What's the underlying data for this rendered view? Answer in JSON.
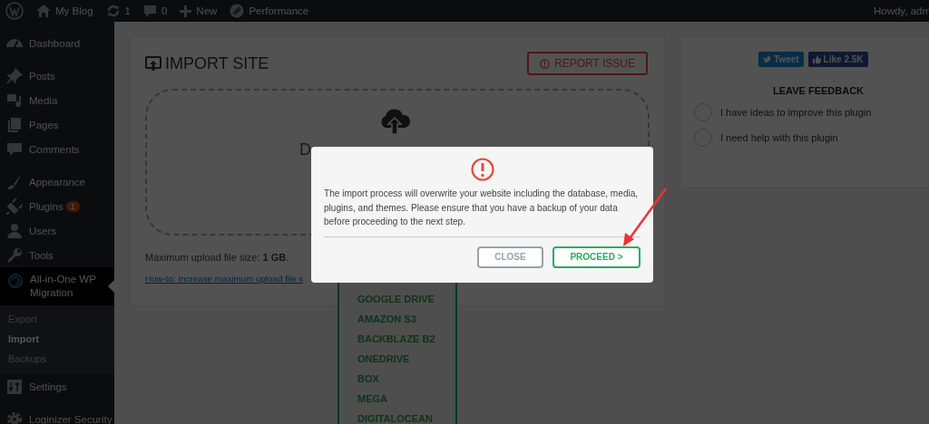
{
  "admin_bar": {
    "items": [
      {
        "kind": "logo"
      },
      {
        "kind": "home",
        "label": "My Blog"
      },
      {
        "kind": "updates",
        "label": "1"
      },
      {
        "kind": "comments",
        "label": "0"
      },
      {
        "kind": "new",
        "label": "New"
      },
      {
        "kind": "performance",
        "label": "Performance"
      }
    ],
    "greeting": "Howdy, adm"
  },
  "sidebar": {
    "groups": [
      {
        "items": [
          {
            "kind": "dashboard",
            "label": "Dashboard",
            "selected": false
          }
        ]
      },
      {
        "items": [
          {
            "kind": "pin",
            "label": "Posts",
            "selected": false
          },
          {
            "kind": "media",
            "label": "Media",
            "selected": false
          },
          {
            "kind": "pages",
            "label": "Pages",
            "selected": false
          },
          {
            "kind": "comments",
            "label": "Comments",
            "selected": false
          }
        ]
      },
      {
        "items": [
          {
            "kind": "brush",
            "label": "Appearance",
            "selected": false
          },
          {
            "kind": "plug",
            "label": "Plugins",
            "selected": false,
            "badge": "1"
          },
          {
            "kind": "user",
            "label": "Users",
            "selected": false
          },
          {
            "kind": "wrench",
            "label": "Tools",
            "selected": false
          },
          {
            "kind": "migration",
            "label": "All-in-One WP Migration",
            "selected": true,
            "children": [
              {
                "label": "Export",
                "selected": false
              },
              {
                "label": "Import",
                "selected": true
              },
              {
                "label": "Backups",
                "selected": false
              }
            ]
          },
          {
            "kind": "settings",
            "label": "Settings",
            "selected": false
          }
        ]
      },
      {
        "items": [
          {
            "kind": "gear",
            "label": "Loginizer Security",
            "selected": false
          }
        ]
      }
    ]
  },
  "import_panel": {
    "title": "IMPORT SITE",
    "report_button": "REPORT ISSUE",
    "drop_text": "D",
    "max_size": "Maximum upload file size: **1 GB**.",
    "help_link": "How-to: Increase maximum upload file s",
    "import_from": [
      "GOOGLE DRIVE",
      "AMAZON S3",
      "BACKBLAZE B2",
      "ONEDRIVE",
      "BOX",
      "MEGA",
      "DIGITALOCEAN"
    ]
  },
  "feedback": {
    "tweet": "Tweet",
    "like": "Like 2.5K",
    "title": "LEAVE FEEDBACK",
    "options": [
      {
        "label": "I have ideas to improve this plugin",
        "selected": false
      },
      {
        "label": "I need help with this plugin",
        "selected": false
      }
    ]
  },
  "dialog": {
    "message": "The import process will overwrite your website including the database, media, plugins, and themes. Please ensure that you have a backup of your data before proceeding to the next step.",
    "buttons": [
      {
        "kind": "close",
        "label": "CLOSE"
      },
      {
        "kind": "proceed",
        "label": "PROCEED >"
      }
    ]
  }
}
